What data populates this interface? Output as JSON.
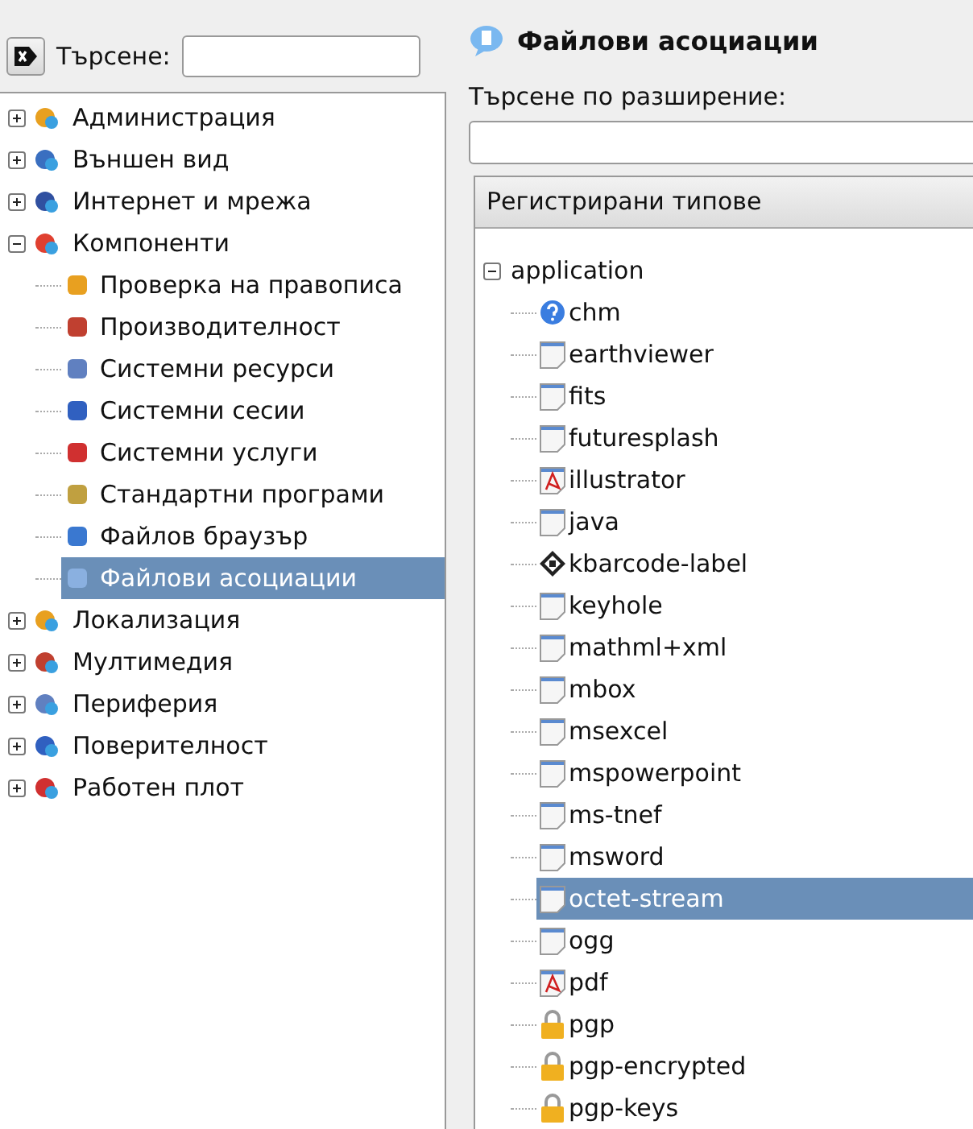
{
  "search": {
    "label": "Търсене:"
  },
  "sidebar": {
    "items": [
      {
        "label": "Администрация",
        "expanded": false,
        "selected": false
      },
      {
        "label": "Външен вид",
        "expanded": false,
        "selected": false
      },
      {
        "label": "Интернет и мрежа",
        "expanded": false,
        "selected": false
      },
      {
        "label": "Компоненти",
        "expanded": true,
        "selected": false,
        "children": [
          {
            "label": "Проверка на правописа",
            "selected": false
          },
          {
            "label": "Производителност",
            "selected": false
          },
          {
            "label": "Системни ресурси",
            "selected": false
          },
          {
            "label": "Системни сесии",
            "selected": false
          },
          {
            "label": "Системни услуги",
            "selected": false
          },
          {
            "label": "Стандартни програми",
            "selected": false
          },
          {
            "label": "Файлов браузър",
            "selected": false
          },
          {
            "label": "Файлови асоциации",
            "selected": true
          }
        ]
      },
      {
        "label": "Локализация",
        "expanded": false,
        "selected": false
      },
      {
        "label": "Мултимедия",
        "expanded": false,
        "selected": false
      },
      {
        "label": "Периферия",
        "expanded": false,
        "selected": false
      },
      {
        "label": "Поверителност",
        "expanded": false,
        "selected": false
      },
      {
        "label": "Работен плот",
        "expanded": false,
        "selected": false
      }
    ]
  },
  "panel": {
    "title": "Файлови асоциации",
    "filter_label": "Търсене по разширение:",
    "types": {
      "header": "Регистрирани типове",
      "groups": [
        {
          "label": "application",
          "expanded": true,
          "children": [
            {
              "label": "chm",
              "selected": false
            },
            {
              "label": "earthviewer",
              "selected": false
            },
            {
              "label": "fits",
              "selected": false
            },
            {
              "label": "futuresplash",
              "selected": false
            },
            {
              "label": "illustrator",
              "selected": false
            },
            {
              "label": "java",
              "selected": false
            },
            {
              "label": "kbarcode-label",
              "selected": false
            },
            {
              "label": "keyhole",
              "selected": false
            },
            {
              "label": "mathml+xml",
              "selected": false
            },
            {
              "label": "mbox",
              "selected": false
            },
            {
              "label": "msexcel",
              "selected": false
            },
            {
              "label": "mspowerpoint",
              "selected": false
            },
            {
              "label": "ms-tnef",
              "selected": false
            },
            {
              "label": "msword",
              "selected": false
            },
            {
              "label": "octet-stream",
              "selected": true
            },
            {
              "label": "ogg",
              "selected": false
            },
            {
              "label": "pdf",
              "selected": false
            },
            {
              "label": "pgp",
              "selected": false
            },
            {
              "label": "pgp-encrypted",
              "selected": false
            },
            {
              "label": "pgp-keys",
              "selected": false
            }
          ]
        }
      ]
    }
  }
}
